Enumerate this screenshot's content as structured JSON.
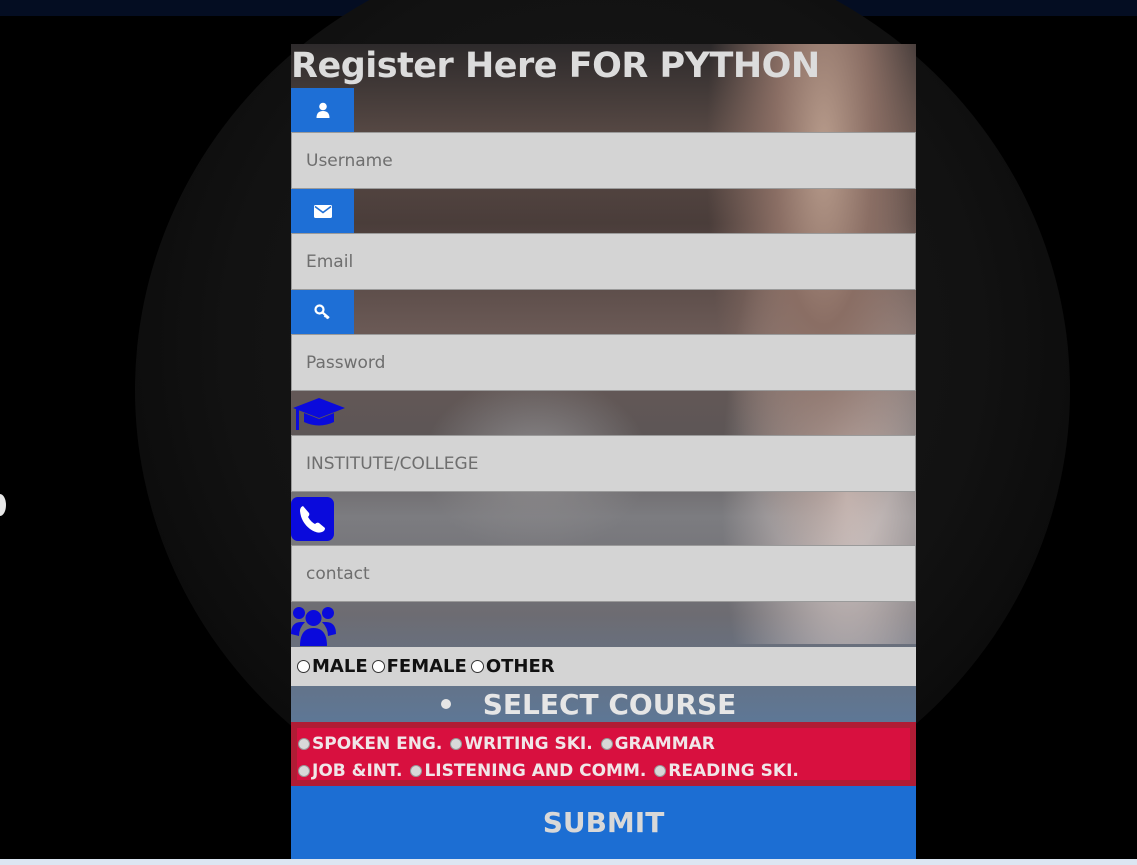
{
  "form": {
    "title": "Register Here FOR PYTHON",
    "fields": {
      "username_placeholder": "Username",
      "email_placeholder": "Email",
      "password_placeholder": "Password",
      "institute_placeholder": "INSTITUTE/COLLEGE",
      "contact_placeholder": "contact"
    },
    "gender": {
      "options": [
        "MALE",
        "FEMALE",
        "OTHER"
      ]
    },
    "course": {
      "heading": "SELECT COURSE",
      "options_row1": [
        "SPOKEN ENG.",
        "WRITING SKI.",
        "GRAMMAR"
      ],
      "options_row2": [
        "JOB &INT.",
        "LISTENING AND COMM.",
        "READING SKI."
      ]
    },
    "submit_label": "SUBMIT"
  },
  "colors": {
    "icon_blue": "#1e6fd6",
    "accent_icon": "#0a0adc",
    "course_red": "#d8103f",
    "submit_blue": "#1c6ed3"
  },
  "icons": [
    "user-icon",
    "envelope-icon",
    "key-icon",
    "graduation-cap-icon",
    "phone-icon",
    "users-icon"
  ]
}
